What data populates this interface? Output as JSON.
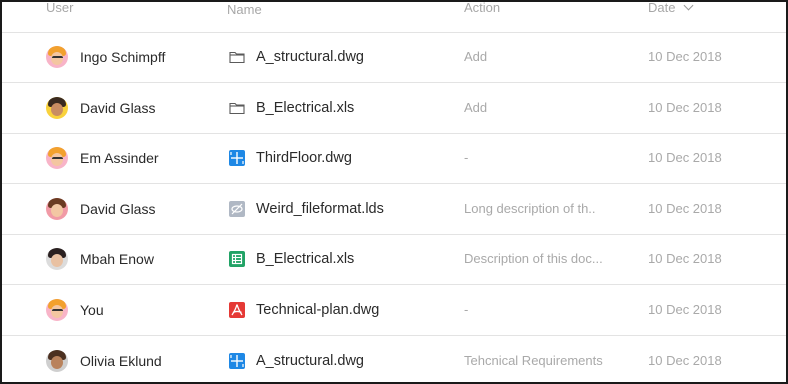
{
  "header": {
    "user": "User",
    "name": "Name",
    "action": "Action",
    "date": "Date"
  },
  "rows": [
    {
      "user": "Ingo Schimpff",
      "avatar": "avatar-pink-glasses",
      "file_icon": "folder-icon",
      "file": "A_structural.dwg",
      "action": "Add",
      "date": "10 Dec 2018"
    },
    {
      "user": "David Glass",
      "avatar": "avatar-yellow-man",
      "file_icon": "folder-icon",
      "file": "B_Electrical.xls",
      "action": "Add",
      "date": "10 Dec 2018"
    },
    {
      "user": "Em Assinder",
      "avatar": "avatar-pink-glasses",
      "file_icon": "blueprint-icon",
      "file": "ThirdFloor.dwg",
      "action": "-",
      "date": "10 Dec 2018"
    },
    {
      "user": "David Glass",
      "avatar": "avatar-pink-woman",
      "file_icon": "hidden-file-icon",
      "file": "Weird_fileformat.lds",
      "action": "Long description of th..",
      "date": "10 Dec 2018"
    },
    {
      "user": "Mbah Enow",
      "avatar": "avatar-grey-woman",
      "file_icon": "spreadsheet-icon",
      "file": "B_Electrical.xls",
      "action": "Description of this doc...",
      "date": "10 Dec 2018"
    },
    {
      "user": "You",
      "avatar": "avatar-pink-glasses",
      "file_icon": "pdf-icon",
      "file": "Technical-plan.dwg",
      "action": "-",
      "date": "10 Dec 2018"
    },
    {
      "user": "Olivia Eklund",
      "avatar": "avatar-curly-woman",
      "file_icon": "blueprint-icon",
      "file": "A_structural.dwg",
      "action": "Tehcnical Requirements",
      "date": "10 Dec 2018"
    }
  ],
  "colors": {
    "blueprint": "#1e88e5",
    "spreadsheet": "#21a366",
    "pdf": "#e53935",
    "hidden": "#b0b8c4",
    "folder": "#5a5a5a"
  }
}
